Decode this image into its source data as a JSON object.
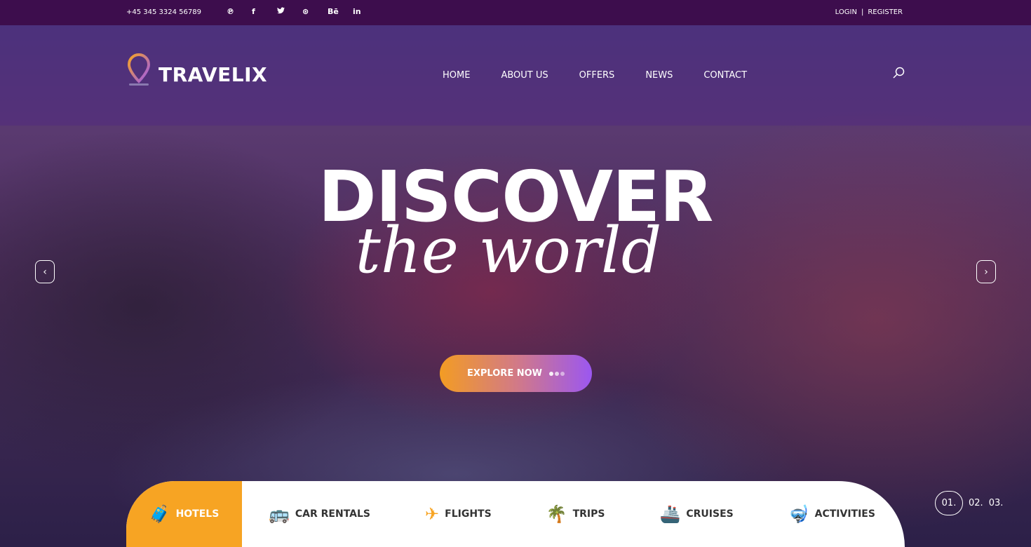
{
  "topbar": {
    "phone": "+45 345 3324 56789",
    "social": [
      {
        "icon": "pinterest-icon",
        "glyph": "℗"
      },
      {
        "icon": "facebook-icon",
        "glyph": "f"
      },
      {
        "icon": "twitter-icon",
        "glyph": "🐦"
      },
      {
        "icon": "dribbble-icon",
        "glyph": "⊛"
      },
      {
        "icon": "behance-icon",
        "glyph": "Bē"
      },
      {
        "icon": "linkedin-icon",
        "glyph": "in"
      }
    ],
    "login": "LOGIN",
    "separator": "|",
    "register": "REGISTER"
  },
  "header": {
    "logo": "TRAVELIX",
    "menu": [
      "HOME",
      "ABOUT US",
      "OFFERS",
      "NEWS",
      "CONTACT"
    ]
  },
  "hero": {
    "title": "DISCOVER",
    "subtitle": "the world",
    "button": "EXPLORE NOW",
    "prev": "‹",
    "next": "›"
  },
  "tabs": [
    {
      "label": "HOTELS",
      "icon": "luggage-icon",
      "glyph": "🧳"
    },
    {
      "label": "CAR RENTALS",
      "icon": "bus-icon",
      "glyph": "🚌"
    },
    {
      "label": "FLIGHTS",
      "icon": "plane-icon",
      "glyph": "✈"
    },
    {
      "label": "TRIPS",
      "icon": "palm-tree-icon",
      "glyph": "🌴"
    },
    {
      "label": "CRUISES",
      "icon": "ship-icon",
      "glyph": "🚢"
    },
    {
      "label": "ACTIVITIES",
      "icon": "snorkel-icon",
      "glyph": "🤿"
    }
  ],
  "pager": [
    "01.",
    "02.",
    "03."
  ],
  "colors": {
    "topbar": "#3d0d4d",
    "accent": "#f7a423",
    "gradient_end": "#9b57f0"
  }
}
